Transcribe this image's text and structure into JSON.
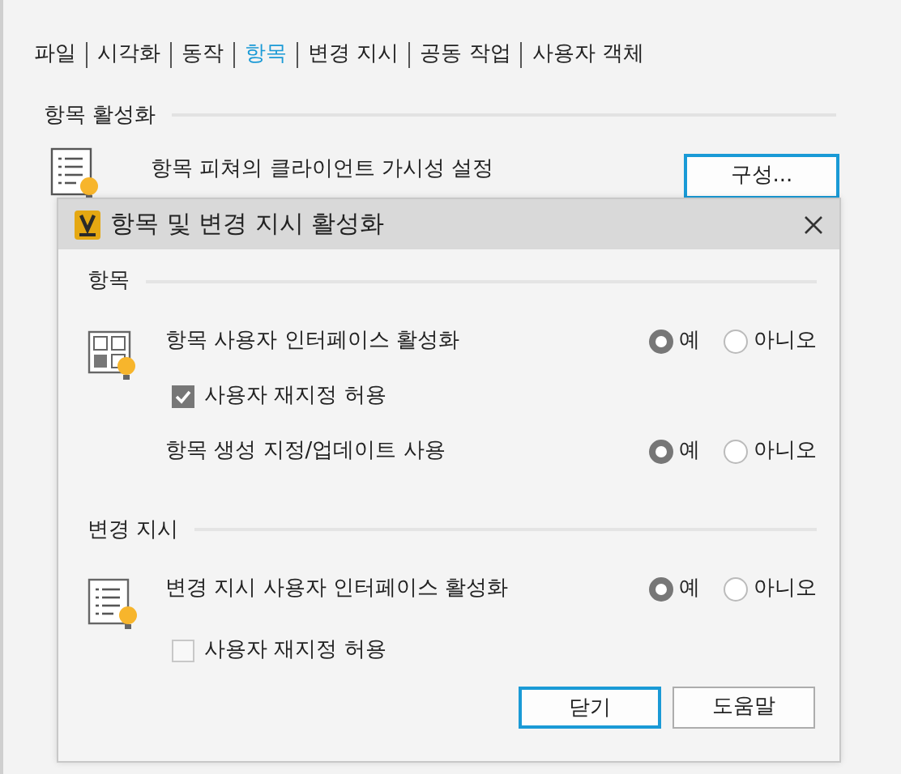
{
  "menu": [
    {
      "label": "파일",
      "selected": false
    },
    {
      "label": "시각화",
      "selected": false
    },
    {
      "label": "동작",
      "selected": false
    },
    {
      "label": "항목",
      "selected": true
    },
    {
      "label": "변경 지시",
      "selected": false
    },
    {
      "label": "공동 작업",
      "selected": false
    },
    {
      "label": "사용자 객체",
      "selected": false
    }
  ],
  "section": {
    "title": "항목 활성화",
    "description": "항목 피쳐의 클라이언트 가시성 설정",
    "button": {
      "label": "구성...",
      "focused": true
    }
  },
  "dialog": {
    "title": "항목 및 변경 지시 활성화",
    "groups": [
      {
        "title": "항목",
        "kind": "grid",
        "rows": [
          {
            "kind": "radio",
            "label": "항목 사용자 인터페이스 활성화",
            "options": [
              {
                "label": "예",
                "selected": true
              },
              {
                "label": "아니오",
                "selected": false
              }
            ]
          },
          {
            "kind": "checkbox",
            "label": "사용자 재지정 허용",
            "checked": true
          },
          {
            "kind": "radio",
            "label": "항목 생성 지정/업데이트 사용",
            "options": [
              {
                "label": "예",
                "selected": true
              },
              {
                "label": "아니오",
                "selected": false
              }
            ]
          }
        ]
      },
      {
        "title": "변경 지시",
        "kind": "list",
        "rows": [
          {
            "kind": "radio",
            "label": "변경 지시 사용자 인터페이스 활성화",
            "options": [
              {
                "label": "예",
                "selected": true
              },
              {
                "label": "아니오",
                "selected": false
              }
            ]
          },
          {
            "kind": "checkbox",
            "label": "사용자 재지정 허용",
            "checked": false
          }
        ]
      }
    ],
    "buttons": [
      {
        "label": "닫기",
        "focused": true
      },
      {
        "label": "도움말",
        "focused": false
      }
    ]
  }
}
